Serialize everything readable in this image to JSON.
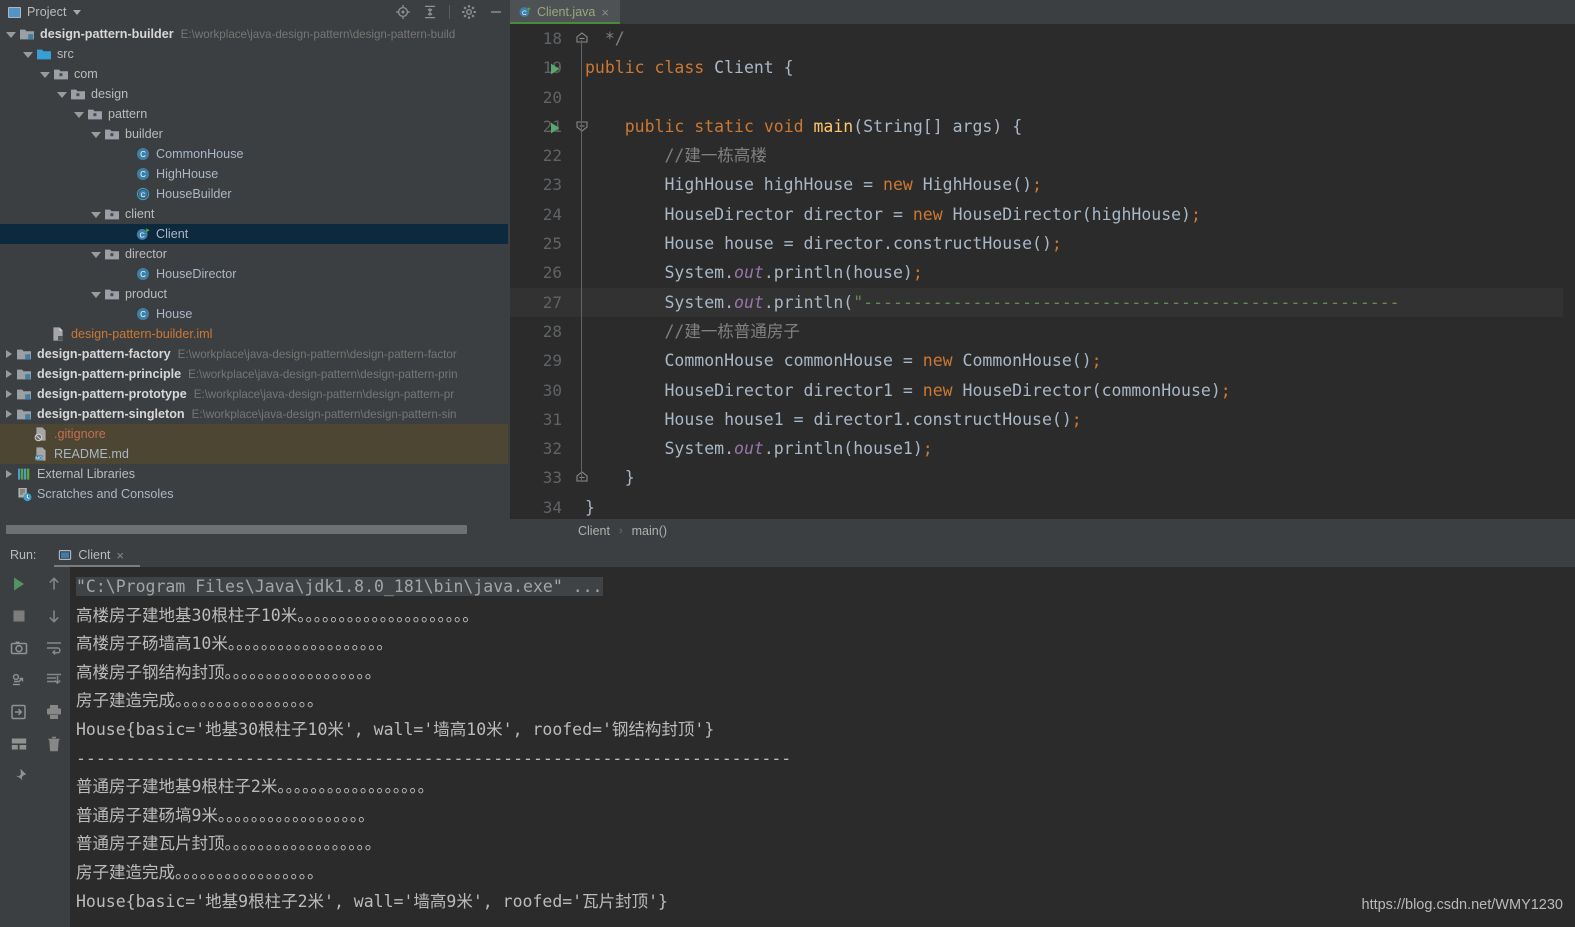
{
  "project_panel": {
    "title": "Project",
    "icons": [
      "project-window-icon",
      "chevron-down-icon",
      "locate-icon",
      "collapse-all-icon",
      "gear-icon",
      "minimize-icon"
    ],
    "tree": [
      {
        "depth": 0,
        "arrow": "open",
        "icon": "module-icon",
        "label": "design-pattern-builder",
        "bold": true,
        "path": "E:\\workplace\\java-design-pattern\\design-pattern-build"
      },
      {
        "depth": 1,
        "arrow": "open",
        "icon": "src-folder-icon",
        "label": "src",
        "bold": false,
        "path": ""
      },
      {
        "depth": 2,
        "arrow": "open",
        "icon": "package-icon",
        "label": "com",
        "bold": false,
        "path": ""
      },
      {
        "depth": 3,
        "arrow": "open",
        "icon": "package-icon",
        "label": "design",
        "bold": false,
        "path": ""
      },
      {
        "depth": 4,
        "arrow": "open",
        "icon": "package-icon",
        "label": "pattern",
        "bold": false,
        "path": ""
      },
      {
        "depth": 5,
        "arrow": "open",
        "icon": "package-icon",
        "label": "builder",
        "bold": false,
        "path": ""
      },
      {
        "depth": 7,
        "arrow": "blank",
        "icon": "class-icon",
        "label": "CommonHouse",
        "bold": false,
        "path": ""
      },
      {
        "depth": 7,
        "arrow": "blank",
        "icon": "class-icon",
        "label": "HighHouse",
        "bold": false,
        "path": ""
      },
      {
        "depth": 7,
        "arrow": "blank",
        "icon": "interface-icon",
        "label": "HouseBuilder",
        "bold": false,
        "path": ""
      },
      {
        "depth": 5,
        "arrow": "open",
        "icon": "package-icon",
        "label": "client",
        "bold": false,
        "path": ""
      },
      {
        "depth": 7,
        "arrow": "blank",
        "icon": "runnable-class-icon",
        "label": "Client",
        "bold": false,
        "path": "",
        "selected": true
      },
      {
        "depth": 5,
        "arrow": "open",
        "icon": "package-icon",
        "label": "director",
        "bold": false,
        "path": ""
      },
      {
        "depth": 7,
        "arrow": "blank",
        "icon": "class-icon",
        "label": "HouseDirector",
        "bold": false,
        "path": ""
      },
      {
        "depth": 5,
        "arrow": "open",
        "icon": "package-icon",
        "label": "product",
        "bold": false,
        "path": ""
      },
      {
        "depth": 7,
        "arrow": "blank",
        "icon": "class-icon",
        "label": "House",
        "bold": false,
        "path": ""
      },
      {
        "depth": 2,
        "arrow": "blank",
        "icon": "iml-file-icon",
        "label": "design-pattern-builder.iml",
        "bold": false,
        "path": "",
        "style": "iml"
      },
      {
        "depth": 0,
        "arrow": "closed",
        "icon": "module-icon",
        "label": "design-pattern-factory",
        "bold": true,
        "path": "E:\\workplace\\java-design-pattern\\design-pattern-factor"
      },
      {
        "depth": 0,
        "arrow": "closed",
        "icon": "module-icon",
        "label": "design-pattern-principle",
        "bold": true,
        "path": "E:\\workplace\\java-design-pattern\\design-pattern-prin"
      },
      {
        "depth": 0,
        "arrow": "closed",
        "icon": "module-icon",
        "label": "design-pattern-prototype",
        "bold": true,
        "path": "E:\\workplace\\java-design-pattern\\design-pattern-pr"
      },
      {
        "depth": 0,
        "arrow": "closed",
        "icon": "module-icon",
        "label": "design-pattern-singleton",
        "bold": true,
        "path": "E:\\workplace\\java-design-pattern\\design-pattern-sin"
      },
      {
        "depth": 1,
        "arrow": "blank",
        "icon": "gitignore-icon",
        "label": ".gitignore",
        "bold": false,
        "path": "",
        "style": "git",
        "vcs": true
      },
      {
        "depth": 1,
        "arrow": "blank",
        "icon": "markdown-icon",
        "label": "README.md",
        "bold": false,
        "path": "",
        "vcs": true
      },
      {
        "depth": 0,
        "arrow": "closed",
        "icon": "libraries-icon",
        "label": "External Libraries",
        "bold": false,
        "path": ""
      },
      {
        "depth": 0,
        "arrow": "blank",
        "icon": "scratches-icon",
        "label": "Scratches and Consoles",
        "bold": false,
        "path": ""
      }
    ]
  },
  "editor": {
    "tab": {
      "label": "Client.java",
      "icon": "runnable-class-icon",
      "close": "×"
    },
    "breadcrumb": {
      "class": "Client",
      "separator": "›",
      "method": "main()"
    },
    "code_lines": [
      {
        "num": "18",
        "fold": "fold-end",
        "run": false,
        "hl": false,
        "tokens": [
          {
            "t": "  ",
            "c": ""
          },
          {
            "t": "*/",
            "c": "k-cmt"
          }
        ]
      },
      {
        "num": "19",
        "fold": "",
        "run": true,
        "hl": false,
        "tokens": [
          {
            "t": "public class ",
            "c": "k-kw"
          },
          {
            "t": "Client",
            "c": "k-cls"
          },
          {
            "t": " {",
            "c": ""
          }
        ]
      },
      {
        "num": "20",
        "fold": "",
        "run": false,
        "hl": false,
        "tokens": []
      },
      {
        "num": "21",
        "fold": "fold-start",
        "run": true,
        "hl": false,
        "tokens": [
          {
            "t": "    ",
            "c": ""
          },
          {
            "t": "public static void ",
            "c": "k-kw"
          },
          {
            "t": "main",
            "c": "k-fn"
          },
          {
            "t": "(String[] args) {",
            "c": ""
          }
        ]
      },
      {
        "num": "22",
        "fold": "",
        "run": false,
        "hl": false,
        "tokens": [
          {
            "t": "        //建一栋高楼",
            "c": "k-cmt"
          }
        ]
      },
      {
        "num": "23",
        "fold": "",
        "run": false,
        "hl": false,
        "tokens": [
          {
            "t": "        HighHouse highHouse = ",
            "c": ""
          },
          {
            "t": "new ",
            "c": "k-kw"
          },
          {
            "t": "HighHouse()",
            "c": ""
          },
          {
            "t": ";",
            "c": "k-semi"
          }
        ]
      },
      {
        "num": "24",
        "fold": "",
        "run": false,
        "hl": false,
        "tokens": [
          {
            "t": "        HouseDirector director = ",
            "c": ""
          },
          {
            "t": "new ",
            "c": "k-kw"
          },
          {
            "t": "HouseDirector(highHouse)",
            "c": ""
          },
          {
            "t": ";",
            "c": "k-semi"
          }
        ]
      },
      {
        "num": "25",
        "fold": "",
        "run": false,
        "hl": false,
        "tokens": [
          {
            "t": "        House house = director.constructHouse()",
            "c": ""
          },
          {
            "t": ";",
            "c": "k-semi"
          }
        ]
      },
      {
        "num": "26",
        "fold": "",
        "run": false,
        "hl": false,
        "tokens": [
          {
            "t": "        System.",
            "c": ""
          },
          {
            "t": "out",
            "c": "k-stat"
          },
          {
            "t": ".println(house)",
            "c": ""
          },
          {
            "t": ";",
            "c": "k-semi"
          }
        ]
      },
      {
        "num": "27",
        "fold": "",
        "run": false,
        "hl": true,
        "tokens": [
          {
            "t": "        System.",
            "c": ""
          },
          {
            "t": "out",
            "c": "k-stat"
          },
          {
            "t": ".println(",
            "c": ""
          },
          {
            "t": "\"------------------------------------------------------",
            "c": "k-str"
          }
        ]
      },
      {
        "num": "28",
        "fold": "",
        "run": false,
        "hl": false,
        "tokens": [
          {
            "t": "        //建一栋普通房子",
            "c": "k-cmt"
          }
        ]
      },
      {
        "num": "29",
        "fold": "",
        "run": false,
        "hl": false,
        "tokens": [
          {
            "t": "        CommonHouse commonHouse = ",
            "c": ""
          },
          {
            "t": "new ",
            "c": "k-kw"
          },
          {
            "t": "CommonHouse()",
            "c": ""
          },
          {
            "t": ";",
            "c": "k-semi"
          }
        ]
      },
      {
        "num": "30",
        "fold": "",
        "run": false,
        "hl": false,
        "tokens": [
          {
            "t": "        HouseDirector director1 = ",
            "c": ""
          },
          {
            "t": "new ",
            "c": "k-kw"
          },
          {
            "t": "HouseDirector(commonHouse)",
            "c": ""
          },
          {
            "t": ";",
            "c": "k-semi"
          }
        ]
      },
      {
        "num": "31",
        "fold": "",
        "run": false,
        "hl": false,
        "tokens": [
          {
            "t": "        House house1 = director1.constructHouse()",
            "c": ""
          },
          {
            "t": ";",
            "c": "k-semi"
          }
        ]
      },
      {
        "num": "32",
        "fold": "",
        "run": false,
        "hl": false,
        "tokens": [
          {
            "t": "        System.",
            "c": ""
          },
          {
            "t": "out",
            "c": "k-stat"
          },
          {
            "t": ".println(house1)",
            "c": ""
          },
          {
            "t": ";",
            "c": "k-semi"
          }
        ]
      },
      {
        "num": "33",
        "fold": "fold-end",
        "run": false,
        "hl": false,
        "tokens": [
          {
            "t": "    }",
            "c": ""
          }
        ]
      },
      {
        "num": "34",
        "fold": "",
        "run": false,
        "hl": false,
        "tokens": [
          {
            "t": "}",
            "c": ""
          }
        ]
      }
    ]
  },
  "run_panel": {
    "label": "Run:",
    "tab": {
      "label": "Client",
      "icon": "console-window-icon",
      "close": "×"
    },
    "toolbar_left": [
      "rerun-icon",
      "stop-icon",
      "camera-icon",
      "thread-dump-icon",
      "export-icon",
      "layout-icon",
      "pin-icon"
    ],
    "toolbar_right": [
      "scroll-up-icon",
      "scroll-down-icon",
      "soft-wrap-icon",
      "scroll-to-end-icon",
      "print-icon",
      "trash-icon"
    ],
    "console_lines": [
      {
        "text": "\"C:\\Program Files\\Java\\jdk1.8.0_181\\bin\\java.exe\" ...",
        "style": "cmd"
      },
      {
        "text": "高楼房子建地基30根柱子10米。。。。。。。。。。。。。。。。。。。。。",
        "style": ""
      },
      {
        "text": "高楼房子砀墙高10米。。。。。。。。。。。。。。。。。。。",
        "style": ""
      },
      {
        "text": "高楼房子钢结构封顶。。。。。。。。。。。。。。。。。。",
        "style": ""
      },
      {
        "text": "房子建造完成。。。。。。。。。。。。。。。。。",
        "style": ""
      },
      {
        "text": "House{basic='地基30根柱子10米', wall='墙高10米', roofed='钢结构封顶'}",
        "style": ""
      },
      {
        "text": "------------------------------------------------------------------------",
        "style": ""
      },
      {
        "text": "普通房子建地基9根柱子2米。。。。。。。。。。。。。。。。。。",
        "style": ""
      },
      {
        "text": "普通房子建砀塙9米。。。。。。。。。。。。。。。。。。",
        "style": ""
      },
      {
        "text": "普通房子建瓦片封顶。。。。。。。。。。。。。。。。。。",
        "style": ""
      },
      {
        "text": "房子建造完成。。。。。。。。。。。。。。。。。",
        "style": ""
      },
      {
        "text": "House{basic='地基9根柱子2米', wall='墙高9米', roofed='瓦片封顶'}",
        "style": ""
      }
    ]
  },
  "watermark": {
    "text": "https://blog.csdn.net/WMY1230"
  },
  "colors": {
    "bg_panel": "#3c3f41",
    "bg_editor": "#2b2b2b",
    "selection": "#0d293e",
    "vcs_modified": "#4d4632",
    "keyword": "#cc7832",
    "string": "#6a8759",
    "comment": "#808080",
    "text": "#a9b7c6",
    "accent_green": "#4a8a3a"
  }
}
